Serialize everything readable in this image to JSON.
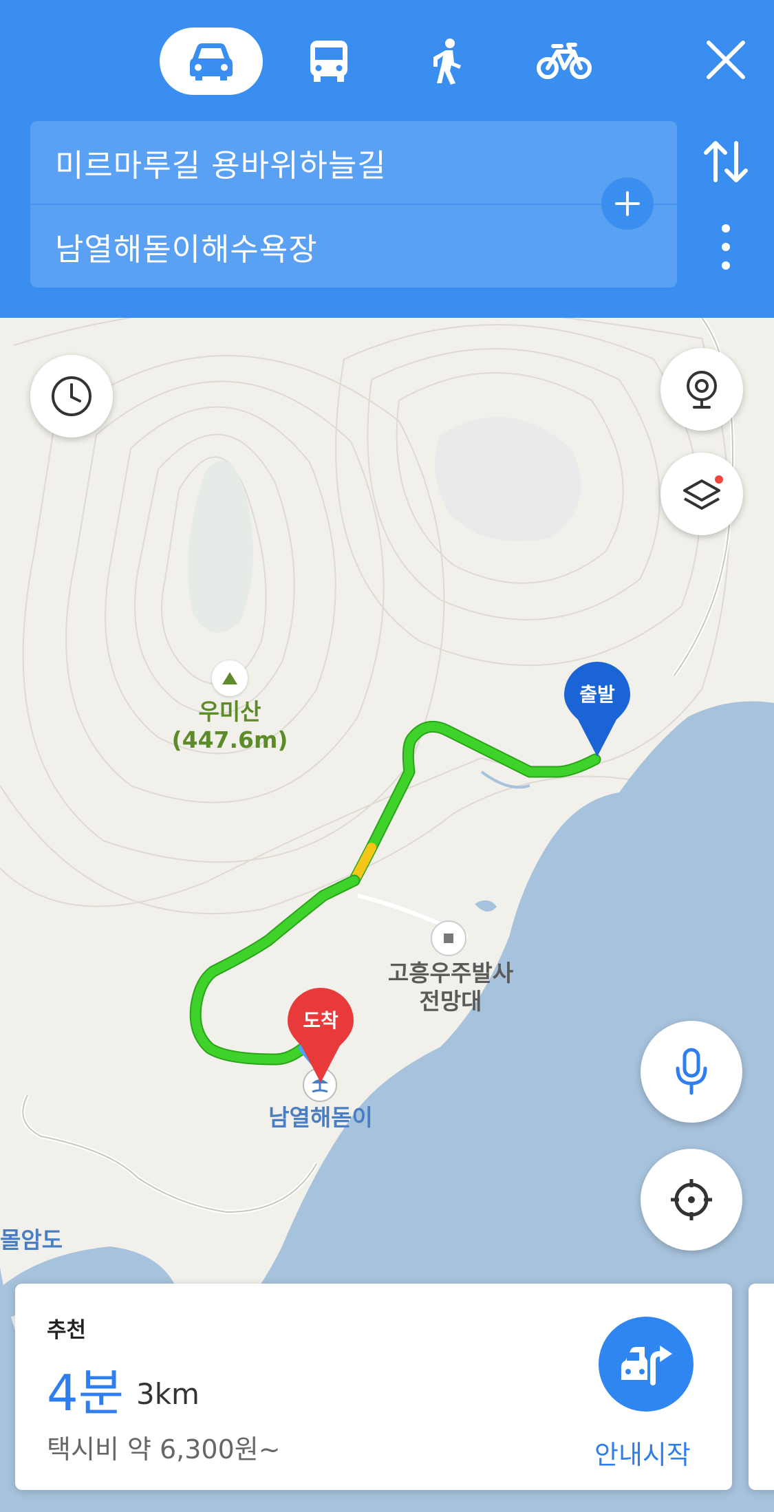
{
  "header": {
    "modes": [
      {
        "name": "car",
        "icon": "car-icon",
        "active": true
      },
      {
        "name": "bus",
        "icon": "bus-icon",
        "active": false
      },
      {
        "name": "walk",
        "icon": "walk-icon",
        "active": false
      },
      {
        "name": "bicycle",
        "icon": "bicycle-icon",
        "active": false
      }
    ],
    "origin": "미르마루길 용바위하늘길",
    "destination": "남열해돋이해수욕장",
    "colors": {
      "bar": "#3a8ef0",
      "search_box": "#5aa1f3"
    }
  },
  "map": {
    "peak": {
      "name": "우미산",
      "height": "(447.6m)"
    },
    "poi": {
      "line1": "고흥우주발사",
      "line2": "전망대"
    },
    "beach": "남열해돋이",
    "island": "몰암도",
    "start_pin": "출발",
    "end_pin": "도착",
    "colors": {
      "route": "#3fd22a",
      "route_slow": "#f5c518",
      "start_pin": "#1a64d6",
      "end_pin": "#e83a3a",
      "water": "#a7c2dc",
      "land": "#f2f0ea"
    }
  },
  "route_card": {
    "label": "추천",
    "duration": "4분",
    "distance": "3km",
    "taxi_fare": "택시비 약 6,300원~",
    "start_label": "안내시작"
  }
}
